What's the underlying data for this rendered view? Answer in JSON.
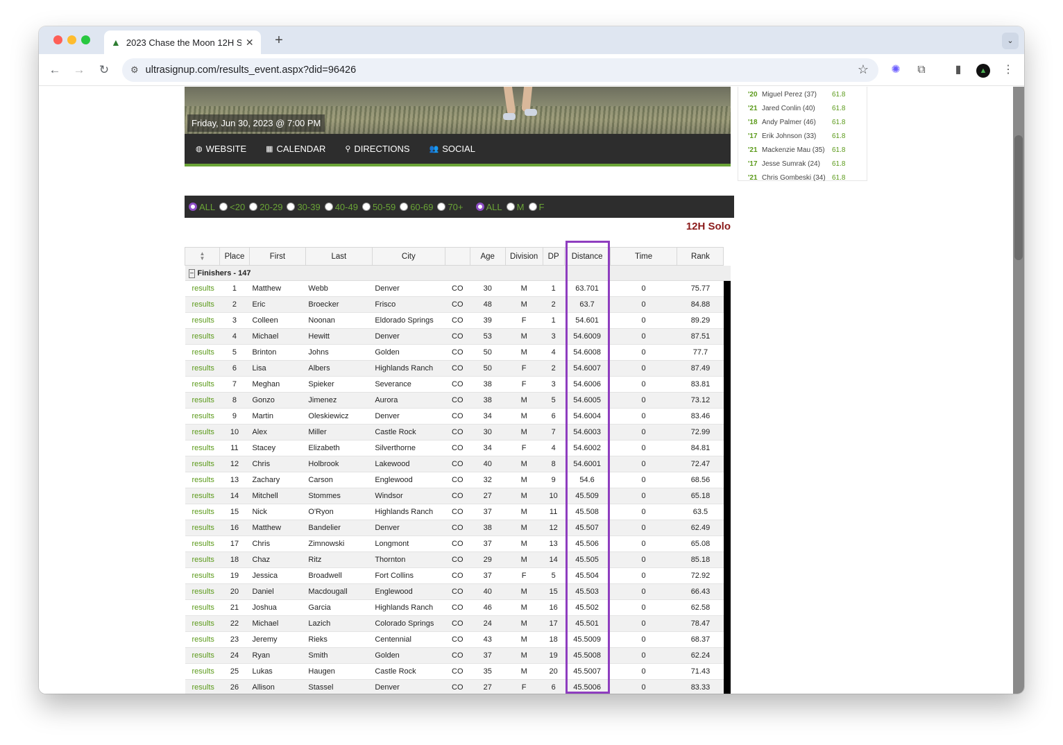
{
  "browser": {
    "tab_title": "2023 Chase the Moon 12H S",
    "url": "ultrasignup.com/results_event.aspx?did=96426"
  },
  "event": {
    "date_banner": "Friday, Jun 30, 2023 @ 7:00 PM",
    "nav": [
      "WEBSITE",
      "CALENDAR",
      "DIRECTIONS",
      "SOCIAL"
    ]
  },
  "sidebar": [
    {
      "year": "'20",
      "name": "Miguel Perez (37)",
      "value": "61.8"
    },
    {
      "year": "'21",
      "name": "Jared Conlin (40)",
      "value": "61.8"
    },
    {
      "year": "'18",
      "name": "Andy Palmer (46)",
      "value": "61.8"
    },
    {
      "year": "'17",
      "name": "Erik Johnson (33)",
      "value": "61.8"
    },
    {
      "year": "'21",
      "name": "Mackenzie Mau (35)",
      "value": "61.8"
    },
    {
      "year": "'17",
      "name": "Jesse Sumrak (24)",
      "value": "61.8"
    },
    {
      "year": "'21",
      "name": "Chris Gombeski (34)",
      "value": "61.8"
    }
  ],
  "filters": {
    "age": [
      "ALL",
      "<20",
      "20-29",
      "30-39",
      "40-49",
      "50-59",
      "60-69",
      "70+"
    ],
    "gender": [
      "ALL",
      "M",
      "F"
    ],
    "selected_age": "ALL",
    "selected_gender": "ALL"
  },
  "category_title": "12H Solo",
  "table": {
    "headers": [
      "",
      "Place",
      "First",
      "Last",
      "City",
      "",
      "Age",
      "Division",
      "DP",
      "Distance",
      "Time",
      "Rank"
    ],
    "group_label": "Finishers - 147",
    "link_label": "results",
    "rows": [
      [
        "1",
        "Matthew",
        "Webb",
        "Denver",
        "CO",
        "30",
        "M",
        "1",
        "63.701",
        "0",
        "75.77"
      ],
      [
        "2",
        "Eric",
        "Broecker",
        "Frisco",
        "CO",
        "48",
        "M",
        "2",
        "63.7",
        "0",
        "84.88"
      ],
      [
        "3",
        "Colleen",
        "Noonan",
        "Eldorado Springs",
        "CO",
        "39",
        "F",
        "1",
        "54.601",
        "0",
        "89.29"
      ],
      [
        "4",
        "Michael",
        "Hewitt",
        "Denver",
        "CO",
        "53",
        "M",
        "3",
        "54.6009",
        "0",
        "87.51"
      ],
      [
        "5",
        "Brinton",
        "Johns",
        "Golden",
        "CO",
        "50",
        "M",
        "4",
        "54.6008",
        "0",
        "77.7"
      ],
      [
        "6",
        "Lisa",
        "Albers",
        "Highlands Ranch",
        "CO",
        "50",
        "F",
        "2",
        "54.6007",
        "0",
        "87.49"
      ],
      [
        "7",
        "Meghan",
        "Spieker",
        "Severance",
        "CO",
        "38",
        "F",
        "3",
        "54.6006",
        "0",
        "83.81"
      ],
      [
        "8",
        "Gonzo",
        "Jimenez",
        "Aurora",
        "CO",
        "38",
        "M",
        "5",
        "54.6005",
        "0",
        "73.12"
      ],
      [
        "9",
        "Martin",
        "Oleskiewicz",
        "Denver",
        "CO",
        "34",
        "M",
        "6",
        "54.6004",
        "0",
        "83.46"
      ],
      [
        "10",
        "Alex",
        "Miller",
        "Castle Rock",
        "CO",
        "30",
        "M",
        "7",
        "54.6003",
        "0",
        "72.99"
      ],
      [
        "11",
        "Stacey",
        "Elizabeth",
        "Silverthorne",
        "CO",
        "34",
        "F",
        "4",
        "54.6002",
        "0",
        "84.81"
      ],
      [
        "12",
        "Chris",
        "Holbrook",
        "Lakewood",
        "CO",
        "40",
        "M",
        "8",
        "54.6001",
        "0",
        "72.47"
      ],
      [
        "13",
        "Zachary",
        "Carson",
        "Englewood",
        "CO",
        "32",
        "M",
        "9",
        "54.6",
        "0",
        "68.56"
      ],
      [
        "14",
        "Mitchell",
        "Stommes",
        "Windsor",
        "CO",
        "27",
        "M",
        "10",
        "45.509",
        "0",
        "65.18"
      ],
      [
        "15",
        "Nick",
        "O'Ryon",
        "Highlands Ranch",
        "CO",
        "37",
        "M",
        "11",
        "45.508",
        "0",
        "63.5"
      ],
      [
        "16",
        "Matthew",
        "Bandelier",
        "Denver",
        "CO",
        "38",
        "M",
        "12",
        "45.507",
        "0",
        "62.49"
      ],
      [
        "17",
        "Chris",
        "Zimnowski",
        "Longmont",
        "CO",
        "37",
        "M",
        "13",
        "45.506",
        "0",
        "65.08"
      ],
      [
        "18",
        "Chaz",
        "Ritz",
        "Thornton",
        "CO",
        "29",
        "M",
        "14",
        "45.505",
        "0",
        "85.18"
      ],
      [
        "19",
        "Jessica",
        "Broadwell",
        "Fort Collins",
        "CO",
        "37",
        "F",
        "5",
        "45.504",
        "0",
        "72.92"
      ],
      [
        "20",
        "Daniel",
        "Macdougall",
        "Englewood",
        "CO",
        "40",
        "M",
        "15",
        "45.503",
        "0",
        "66.43"
      ],
      [
        "21",
        "Joshua",
        "Garcia",
        "Highlands Ranch",
        "CO",
        "46",
        "M",
        "16",
        "45.502",
        "0",
        "62.58"
      ],
      [
        "22",
        "Michael",
        "Lazich",
        "Colorado Springs",
        "CO",
        "24",
        "M",
        "17",
        "45.501",
        "0",
        "78.47"
      ],
      [
        "23",
        "Jeremy",
        "Rieks",
        "Centennial",
        "CO",
        "43",
        "M",
        "18",
        "45.5009",
        "0",
        "68.37"
      ],
      [
        "24",
        "Ryan",
        "Smith",
        "Golden",
        "CO",
        "37",
        "M",
        "19",
        "45.5008",
        "0",
        "62.24"
      ],
      [
        "25",
        "Lukas",
        "Haugen",
        "Castle Rock",
        "CO",
        "35",
        "M",
        "20",
        "45.5007",
        "0",
        "71.43"
      ],
      [
        "26",
        "Allison",
        "Stassel",
        "Denver",
        "CO",
        "27",
        "F",
        "6",
        "45.5006",
        "0",
        "83.33"
      ]
    ]
  },
  "colors": {
    "accent_green": "#6aa436",
    "highlight": "#8e3dbf",
    "category_red": "#8b1a1a"
  }
}
